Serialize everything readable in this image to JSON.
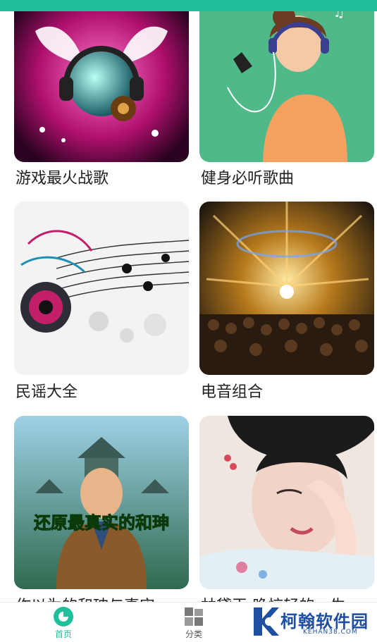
{
  "playlists": [
    {
      "title": "游戏最火战歌",
      "image": "dj-headphones-wings"
    },
    {
      "title": "健身必听歌曲",
      "image": "girl-with-headphones"
    },
    {
      "title": "民谣大全",
      "image": "music-notes-speaker"
    },
    {
      "title": "电音组合",
      "image": "concert-crowd"
    },
    {
      "title": "作以为的和珅与真实...",
      "image": "he-shen-poster",
      "poster_text": "还原最真实的和珅"
    },
    {
      "title": "林黛玉:晚惊轻的一生...",
      "image": "lin-daiyu-portrait"
    }
  ],
  "nav": {
    "home_label": "首页",
    "category_label": "分类",
    "active_color": "#1fbf9c"
  },
  "watermark": {
    "brand": "柯翰软件园",
    "url": "KEHAN38.COM"
  }
}
